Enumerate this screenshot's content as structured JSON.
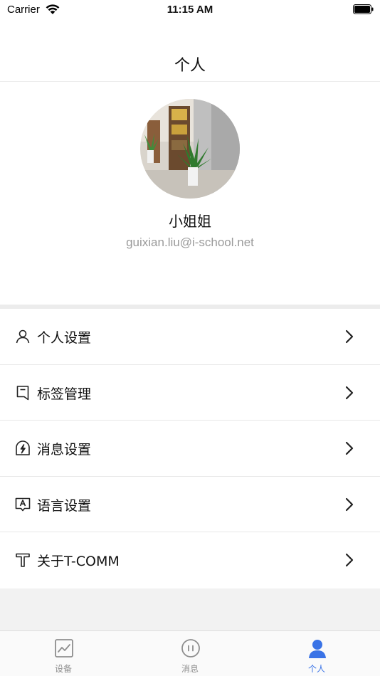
{
  "status_bar": {
    "carrier": "Carrier",
    "time": "11:15 AM"
  },
  "nav": {
    "title": "个人"
  },
  "profile": {
    "name": "小姐姐",
    "email": "guixian.liu@i-school.net"
  },
  "menu": {
    "items": [
      {
        "label": "个人设置",
        "icon": "person-icon"
      },
      {
        "label": "标签管理",
        "icon": "bookmark-tag-icon"
      },
      {
        "label": "消息设置",
        "icon": "notification-bolt-icon"
      },
      {
        "label": "语言设置",
        "icon": "language-icon"
      },
      {
        "label": "关于T-COMM",
        "icon": "about-t-icon"
      }
    ]
  },
  "tabbar": {
    "tabs": [
      {
        "label": "设备",
        "icon": "device-chart-icon",
        "active": false
      },
      {
        "label": "消息",
        "icon": "message-pause-icon",
        "active": false
      },
      {
        "label": "个人",
        "icon": "person-filled-icon",
        "active": true
      }
    ]
  },
  "colors": {
    "accent": "#3a73e6",
    "secondary_text": "#9a9a9a",
    "separator": "#ececec"
  }
}
